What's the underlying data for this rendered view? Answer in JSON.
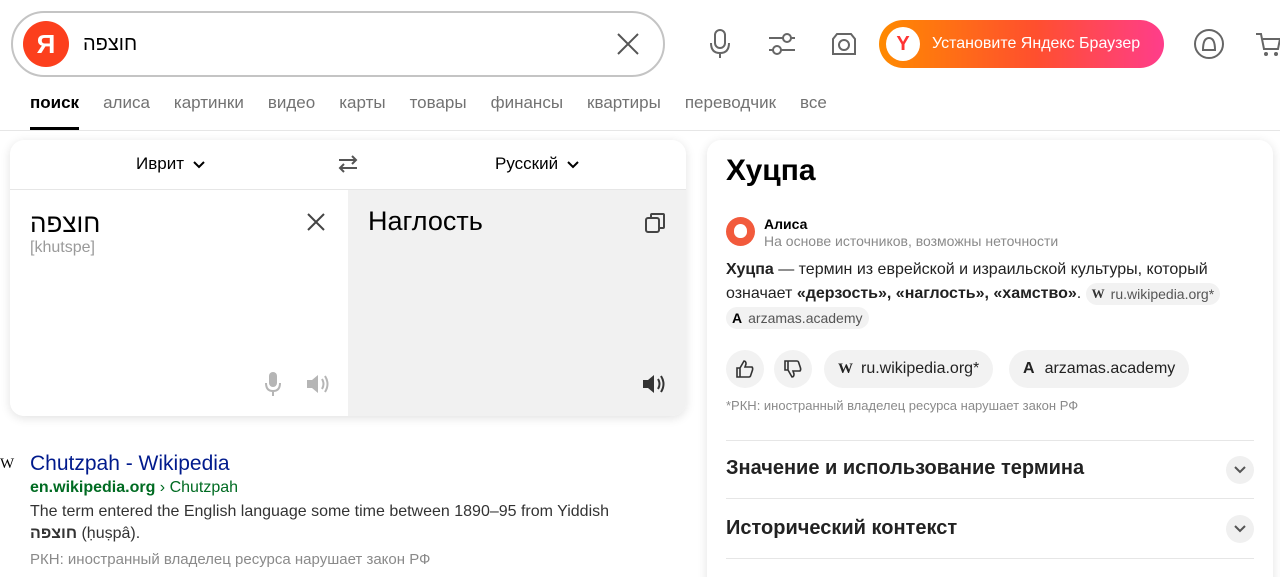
{
  "search": {
    "logo_letter": "Я",
    "query": "חוצפה",
    "browser_button": "Установите Яндекс Браузер",
    "browser_logo_letter": "Y"
  },
  "tabs": [
    {
      "label": "поиск",
      "active": true
    },
    {
      "label": "алиса"
    },
    {
      "label": "картинки"
    },
    {
      "label": "видео"
    },
    {
      "label": "карты"
    },
    {
      "label": "товары"
    },
    {
      "label": "финансы"
    },
    {
      "label": "квартиры"
    },
    {
      "label": "переводчик"
    },
    {
      "label": "все"
    }
  ],
  "translator": {
    "source_lang": "Иврит",
    "target_lang": "Русский",
    "source_text": "חוצפה",
    "transliteration": "[khutspe]",
    "translation": "Наглость"
  },
  "result": {
    "favicon": "W",
    "title": "Chutzpah - Wikipedia",
    "url_domain": "en.wikipedia.org",
    "url_path": " › Chutzpah",
    "snippet_line1": "The term entered the English language some time between 1890–95 from Yiddish",
    "snippet_bold": "חוצפה",
    "snippet_line2": " (ḥuṣpâ).",
    "rkn": "РКН: иностранный владелец ресурса нарушает закон РФ"
  },
  "panel": {
    "title": "Хуцпа",
    "alice_name": "Алиса",
    "alice_sub": "На основе источников, возможны неточности",
    "answer_term": "Хуцпа",
    "answer_text": " — термин из еврейской и израильской культуры, который означает ",
    "answer_bold": "«дерзость», «наглость», «хамство»",
    "answer_end": ".",
    "chip1": "ru.wikipedia.org*",
    "chip2": "arzamas.academy",
    "chip_w": "W",
    "chip_a": "A",
    "source1": "ru.wikipedia.org*",
    "source2": "arzamas.academy",
    "rkn_note": "*РКН: иностранный владелец ресурса нарушает закон РФ",
    "accordion": [
      {
        "title": "Значение и использование термина"
      },
      {
        "title": "Исторический контекст"
      }
    ]
  }
}
